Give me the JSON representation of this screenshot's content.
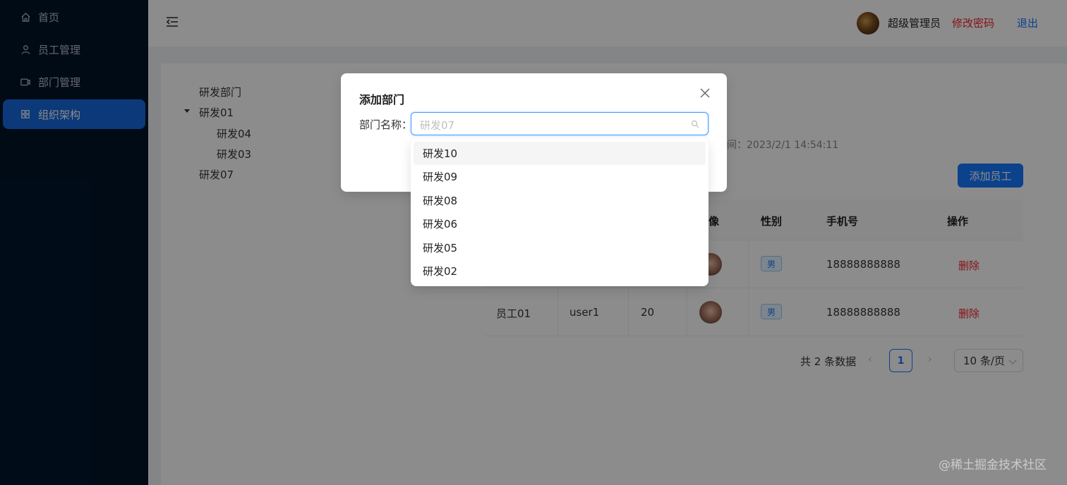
{
  "sidebar": {
    "items": [
      {
        "label": "首页",
        "icon": "home-icon"
      },
      {
        "label": "员工管理",
        "icon": "user-icon"
      },
      {
        "label": "部门管理",
        "icon": "video-icon"
      },
      {
        "label": "组织架构",
        "icon": "grid-icon",
        "active": true
      }
    ]
  },
  "header": {
    "username": "超级管理员",
    "change_password": "修改密码",
    "logout": "退出"
  },
  "tree": {
    "nodes": [
      "研发部门",
      "研发01",
      "研发04",
      "研发03",
      "研发07"
    ]
  },
  "dept_info": {
    "time_text": "间：2023/2/1 14:54:11"
  },
  "add_employee_button": "添加员工",
  "table": {
    "headers": [
      "像",
      "性别",
      "手机号",
      "操作"
    ],
    "rows": [
      {
        "gender": "男",
        "phone": "18888888888",
        "action": "删除"
      },
      {
        "name": "员工01",
        "account": "user1",
        "age": "20",
        "gender": "男",
        "phone": "18888888888",
        "action": "删除"
      }
    ]
  },
  "pagination": {
    "total_text": "共 2 条数据",
    "prev": "‹",
    "next": "›",
    "current_page": "1",
    "page_size": "10 条/页"
  },
  "modal": {
    "title": "添加部门",
    "field_label": "部门名称：",
    "select_placeholder": "研发07",
    "options": [
      "研发10",
      "研发09",
      "研发08",
      "研发06",
      "研发05",
      "研发02"
    ]
  },
  "watermark": "@稀土掘金技术社区",
  "colors": {
    "sidebar_bg": "#001529",
    "primary": "#1677ff",
    "danger": "#f5222d"
  }
}
